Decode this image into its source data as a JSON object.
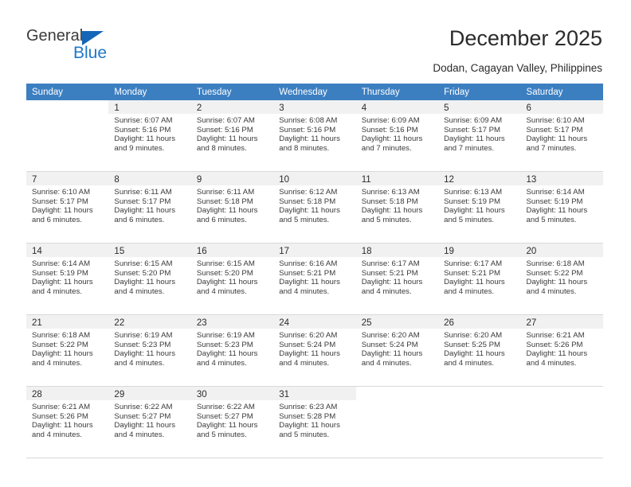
{
  "brand": {
    "name_part1": "General",
    "name_part2": "Blue",
    "triangle_color": "#1565b8"
  },
  "header": {
    "title": "December 2025",
    "subtitle": "Dodan, Cagayan Valley, Philippines",
    "header_bg": "#3c7fc1"
  },
  "weekdays": [
    "Sunday",
    "Monday",
    "Tuesday",
    "Wednesday",
    "Thursday",
    "Friday",
    "Saturday"
  ],
  "weeks": [
    [
      {
        "day": "",
        "sunrise": "",
        "sunset": "",
        "daylight": "",
        "empty": true
      },
      {
        "day": "1",
        "sunrise": "Sunrise: 6:07 AM",
        "sunset": "Sunset: 5:16 PM",
        "daylight": "Daylight: 11 hours and 9 minutes."
      },
      {
        "day": "2",
        "sunrise": "Sunrise: 6:07 AM",
        "sunset": "Sunset: 5:16 PM",
        "daylight": "Daylight: 11 hours and 8 minutes."
      },
      {
        "day": "3",
        "sunrise": "Sunrise: 6:08 AM",
        "sunset": "Sunset: 5:16 PM",
        "daylight": "Daylight: 11 hours and 8 minutes."
      },
      {
        "day": "4",
        "sunrise": "Sunrise: 6:09 AM",
        "sunset": "Sunset: 5:16 PM",
        "daylight": "Daylight: 11 hours and 7 minutes."
      },
      {
        "day": "5",
        "sunrise": "Sunrise: 6:09 AM",
        "sunset": "Sunset: 5:17 PM",
        "daylight": "Daylight: 11 hours and 7 minutes."
      },
      {
        "day": "6",
        "sunrise": "Sunrise: 6:10 AM",
        "sunset": "Sunset: 5:17 PM",
        "daylight": "Daylight: 11 hours and 7 minutes."
      }
    ],
    [
      {
        "day": "7",
        "sunrise": "Sunrise: 6:10 AM",
        "sunset": "Sunset: 5:17 PM",
        "daylight": "Daylight: 11 hours and 6 minutes."
      },
      {
        "day": "8",
        "sunrise": "Sunrise: 6:11 AM",
        "sunset": "Sunset: 5:17 PM",
        "daylight": "Daylight: 11 hours and 6 minutes."
      },
      {
        "day": "9",
        "sunrise": "Sunrise: 6:11 AM",
        "sunset": "Sunset: 5:18 PM",
        "daylight": "Daylight: 11 hours and 6 minutes."
      },
      {
        "day": "10",
        "sunrise": "Sunrise: 6:12 AM",
        "sunset": "Sunset: 5:18 PM",
        "daylight": "Daylight: 11 hours and 5 minutes."
      },
      {
        "day": "11",
        "sunrise": "Sunrise: 6:13 AM",
        "sunset": "Sunset: 5:18 PM",
        "daylight": "Daylight: 11 hours and 5 minutes."
      },
      {
        "day": "12",
        "sunrise": "Sunrise: 6:13 AM",
        "sunset": "Sunset: 5:19 PM",
        "daylight": "Daylight: 11 hours and 5 minutes."
      },
      {
        "day": "13",
        "sunrise": "Sunrise: 6:14 AM",
        "sunset": "Sunset: 5:19 PM",
        "daylight": "Daylight: 11 hours and 5 minutes."
      }
    ],
    [
      {
        "day": "14",
        "sunrise": "Sunrise: 6:14 AM",
        "sunset": "Sunset: 5:19 PM",
        "daylight": "Daylight: 11 hours and 4 minutes."
      },
      {
        "day": "15",
        "sunrise": "Sunrise: 6:15 AM",
        "sunset": "Sunset: 5:20 PM",
        "daylight": "Daylight: 11 hours and 4 minutes."
      },
      {
        "day": "16",
        "sunrise": "Sunrise: 6:15 AM",
        "sunset": "Sunset: 5:20 PM",
        "daylight": "Daylight: 11 hours and 4 minutes."
      },
      {
        "day": "17",
        "sunrise": "Sunrise: 6:16 AM",
        "sunset": "Sunset: 5:21 PM",
        "daylight": "Daylight: 11 hours and 4 minutes."
      },
      {
        "day": "18",
        "sunrise": "Sunrise: 6:17 AM",
        "sunset": "Sunset: 5:21 PM",
        "daylight": "Daylight: 11 hours and 4 minutes."
      },
      {
        "day": "19",
        "sunrise": "Sunrise: 6:17 AM",
        "sunset": "Sunset: 5:21 PM",
        "daylight": "Daylight: 11 hours and 4 minutes."
      },
      {
        "day": "20",
        "sunrise": "Sunrise: 6:18 AM",
        "sunset": "Sunset: 5:22 PM",
        "daylight": "Daylight: 11 hours and 4 minutes."
      }
    ],
    [
      {
        "day": "21",
        "sunrise": "Sunrise: 6:18 AM",
        "sunset": "Sunset: 5:22 PM",
        "daylight": "Daylight: 11 hours and 4 minutes."
      },
      {
        "day": "22",
        "sunrise": "Sunrise: 6:19 AM",
        "sunset": "Sunset: 5:23 PM",
        "daylight": "Daylight: 11 hours and 4 minutes."
      },
      {
        "day": "23",
        "sunrise": "Sunrise: 6:19 AM",
        "sunset": "Sunset: 5:23 PM",
        "daylight": "Daylight: 11 hours and 4 minutes."
      },
      {
        "day": "24",
        "sunrise": "Sunrise: 6:20 AM",
        "sunset": "Sunset: 5:24 PM",
        "daylight": "Daylight: 11 hours and 4 minutes."
      },
      {
        "day": "25",
        "sunrise": "Sunrise: 6:20 AM",
        "sunset": "Sunset: 5:24 PM",
        "daylight": "Daylight: 11 hours and 4 minutes."
      },
      {
        "day": "26",
        "sunrise": "Sunrise: 6:20 AM",
        "sunset": "Sunset: 5:25 PM",
        "daylight": "Daylight: 11 hours and 4 minutes."
      },
      {
        "day": "27",
        "sunrise": "Sunrise: 6:21 AM",
        "sunset": "Sunset: 5:26 PM",
        "daylight": "Daylight: 11 hours and 4 minutes."
      }
    ],
    [
      {
        "day": "28",
        "sunrise": "Sunrise: 6:21 AM",
        "sunset": "Sunset: 5:26 PM",
        "daylight": "Daylight: 11 hours and 4 minutes."
      },
      {
        "day": "29",
        "sunrise": "Sunrise: 6:22 AM",
        "sunset": "Sunset: 5:27 PM",
        "daylight": "Daylight: 11 hours and 4 minutes."
      },
      {
        "day": "30",
        "sunrise": "Sunrise: 6:22 AM",
        "sunset": "Sunset: 5:27 PM",
        "daylight": "Daylight: 11 hours and 5 minutes."
      },
      {
        "day": "31",
        "sunrise": "Sunrise: 6:23 AM",
        "sunset": "Sunset: 5:28 PM",
        "daylight": "Daylight: 11 hours and 5 minutes."
      },
      {
        "day": "",
        "sunrise": "",
        "sunset": "",
        "daylight": "",
        "empty": true
      },
      {
        "day": "",
        "sunrise": "",
        "sunset": "",
        "daylight": "",
        "empty": true
      },
      {
        "day": "",
        "sunrise": "",
        "sunset": "",
        "daylight": "",
        "empty": true
      }
    ]
  ]
}
